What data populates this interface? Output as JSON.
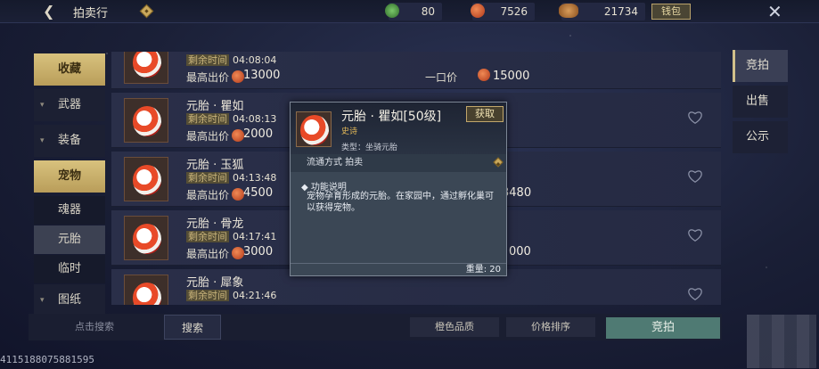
{
  "header": {
    "title": "拍卖行",
    "currency1": "80",
    "currency2": "7526",
    "currency3": "21734",
    "wallet_label": "钱包"
  },
  "nav": {
    "items": [
      "收藏",
      "武器",
      "装备",
      "宠物",
      "魂器",
      "元胎",
      "临时",
      "图纸"
    ]
  },
  "list": {
    "time_label": "剩余时间",
    "bid_label": "最高出价",
    "buy_label": "一口价",
    "rows": [
      {
        "name": "",
        "time": "04:08:04",
        "bid": "13000",
        "buy": "15000"
      },
      {
        "name": "元胎 · 瞿如",
        "time": "04:08:13",
        "bid": "2000",
        "buy": ""
      },
      {
        "name": "元胎 · 玉狐",
        "time": "04:13:48",
        "bid": "4500",
        "buy": "3480"
      },
      {
        "name": "元胎 · 骨龙",
        "time": "04:17:41",
        "bid": "3000",
        "buy": "000"
      },
      {
        "name": "元胎 · 犀象",
        "time": "04:21:46",
        "bid": "",
        "buy": ""
      }
    ]
  },
  "tabs": {
    "items": [
      "竞拍",
      "出售",
      "公示"
    ]
  },
  "tooltip": {
    "name": "元胎 · 瞿如[50级]",
    "get_label": "获取",
    "rarity": "史诗",
    "type": "类型：坐骑元胎",
    "circulation": "流通方式   拍卖",
    "desc_title": "功能说明",
    "desc": "宠物孕育形成的元胎。在家园中，通过孵化巢可以获得宠物。",
    "weight": "重量: 20"
  },
  "bottom": {
    "search_placeholder": "点击搜索",
    "search_btn": "搜索",
    "quality": "橙色品质",
    "price_sort": "价格排序",
    "bid_btn": "竞拍"
  },
  "id_text": "4115188075881595"
}
